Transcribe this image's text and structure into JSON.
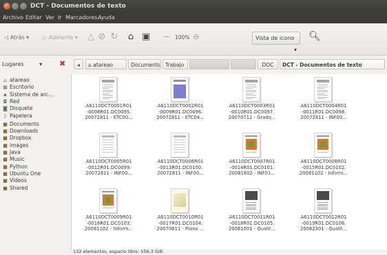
{
  "window": {
    "title": "DCT - Documentos de texto"
  },
  "menubar": [
    "Archivo",
    "Editar",
    "Ver",
    "Ir",
    "Marcadores",
    "Ayuda"
  ],
  "toolbar": {
    "back_label": "Atrás",
    "forward_label": "Adelante",
    "zoom": "100%",
    "view_mode": "Vista de icono"
  },
  "places": {
    "label": "Lugares"
  },
  "breadcrumb": {
    "home": "atareao",
    "items": [
      "Documents",
      "Trabajo"
    ],
    "doc": "DOC",
    "current": "DCT - Documentos de texto"
  },
  "sidebar": [
    {
      "label": "atareao",
      "icon": "home-icon"
    },
    {
      "label": "Escritorio",
      "icon": "desktop-icon"
    },
    {
      "label": "Sistema de arc...",
      "icon": "filesystem-icon"
    },
    {
      "label": "Red",
      "icon": "network-icon"
    },
    {
      "label": "Disquete",
      "icon": "floppy-icon"
    },
    {
      "label": "Papelera",
      "icon": "trash-icon"
    },
    {
      "label": "Documents",
      "icon": "folder-icon"
    },
    {
      "label": "Downloads",
      "icon": "folder-icon"
    },
    {
      "label": "Dropbox",
      "icon": "folder-icon"
    },
    {
      "label": "images",
      "icon": "folder-icon"
    },
    {
      "label": "Java",
      "icon": "folder-icon"
    },
    {
      "label": "Music",
      "icon": "folder-icon"
    },
    {
      "label": "Python",
      "icon": "folder-icon"
    },
    {
      "label": "Ubuntu One",
      "icon": "folder-icon"
    },
    {
      "label": "Videos",
      "icon": "folder-icon"
    },
    {
      "label": "Shared",
      "icon": "folder-icon"
    }
  ],
  "files": [
    {
      "l1": "A6110DCT0001R01",
      "l2": "-0008R01.DC0095.",
      "l3": "20072811 - ETC00...",
      "style": "doc"
    },
    {
      "l1": "A6110DCT0002R01",
      "l2": "-0009R01.DC0096.",
      "l3": "20072811 - ETC04...",
      "style": "blue"
    },
    {
      "l1": "A6110DCT0003R01",
      "l2": "-0010R01.DC0097.",
      "l3": "20070711 - Grado...",
      "style": "doc"
    },
    {
      "l1": "A6110DCT0004R01",
      "l2": "-0011R01.DC0098.",
      "l3": "20072811 - INF00...",
      "style": "doc"
    },
    {
      "l1": "A6110DCT0005R01",
      "l2": "-0012R01.DC0099.",
      "l3": "20072811 - INF00...",
      "style": "table"
    },
    {
      "l1": "A6110DCT0006R01",
      "l2": "-0013R01.DC0100.",
      "l3": "20072811 - INF00...",
      "style": "table"
    },
    {
      "l1": "A6110DCT0007R01",
      "l2": "-0014R01.DC0101.",
      "l3": "20081802 - INF01...",
      "style": "cover"
    },
    {
      "l1": "A6110DCT0008R01",
      "l2": "-0015R01.DC0102.",
      "l3": "20081102 - Inform...",
      "style": "cover"
    },
    {
      "l1": "A6110DCT0009R01",
      "l2": "-0016R01.DC0103.",
      "l3": "20081102 - Inform...",
      "style": "cover"
    },
    {
      "l1": "A6110DCT0010R01",
      "l2": "-0017R01.DC0104.",
      "l3": "20070611 - Plano ...",
      "style": "plan"
    },
    {
      "l1": "A6110DCT0011R01",
      "l2": "-0018R01.DC0105.",
      "l3": "20081001 - Qualit...",
      "style": "dark"
    },
    {
      "l1": "A6110DCT0012R01",
      "l2": "-0019R01.DC0106.",
      "l3": "20082301 - Qualit...",
      "style": "dark"
    }
  ],
  "status": "132 elementos, espacio libre: 556,3 GiB"
}
